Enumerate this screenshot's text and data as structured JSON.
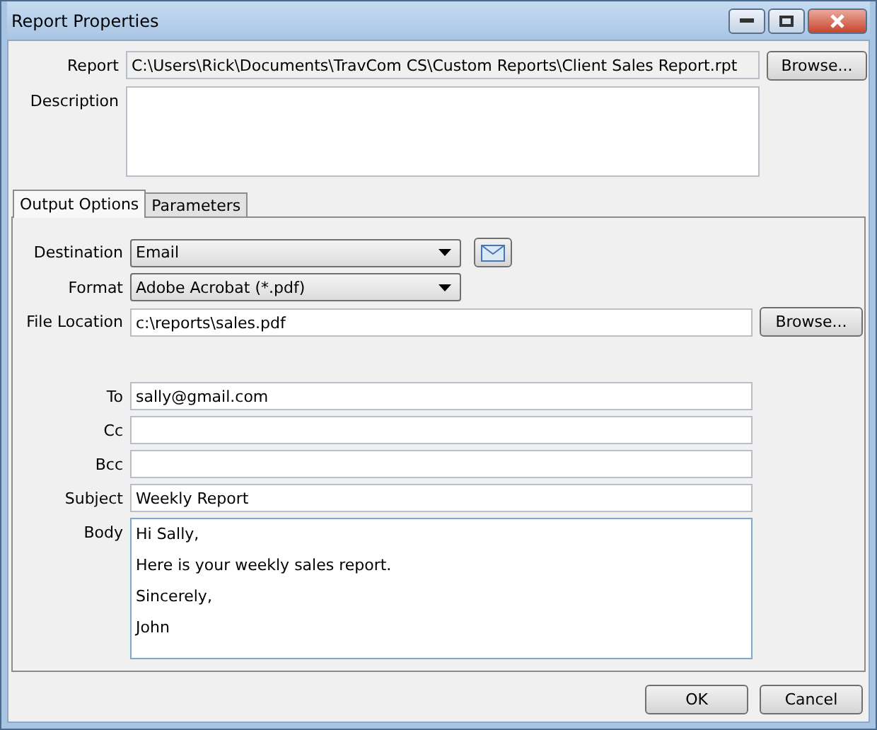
{
  "window": {
    "title": "Report Properties"
  },
  "report": {
    "label": "Report",
    "value": "C:\\Users\\Rick\\Documents\\TravCom CS\\Custom Reports\\Client Sales Report.rpt",
    "button": "Browse..."
  },
  "description": {
    "label": "Description"
  },
  "tabs": [
    {
      "label": "Output Options",
      "selected": true
    },
    {
      "label": "Parameters",
      "selected": false
    }
  ],
  "output": {
    "destination": {
      "label": "Destination",
      "value": "Email"
    },
    "format": {
      "label": "Format",
      "value": "Adobe Acrobat (*.pdf)"
    },
    "file_location": {
      "label": "File Location",
      "value": "c:\\reports\\sales.pdf",
      "button": "Browse..."
    },
    "email_fields": [
      {
        "label": "To",
        "value": "sally@gmail.com"
      },
      {
        "label": "Cc"
      },
      {
        "label": "Bcc"
      },
      {
        "label": "Subject",
        "value": "Weekly Report"
      }
    ],
    "body": {
      "label": "Body",
      "lines": [
        "Hi Sally,",
        "Here is your weekly sales report.",
        "Sincerely,",
        "John"
      ]
    }
  },
  "buttons": [
    "OK",
    "Cancel"
  ]
}
